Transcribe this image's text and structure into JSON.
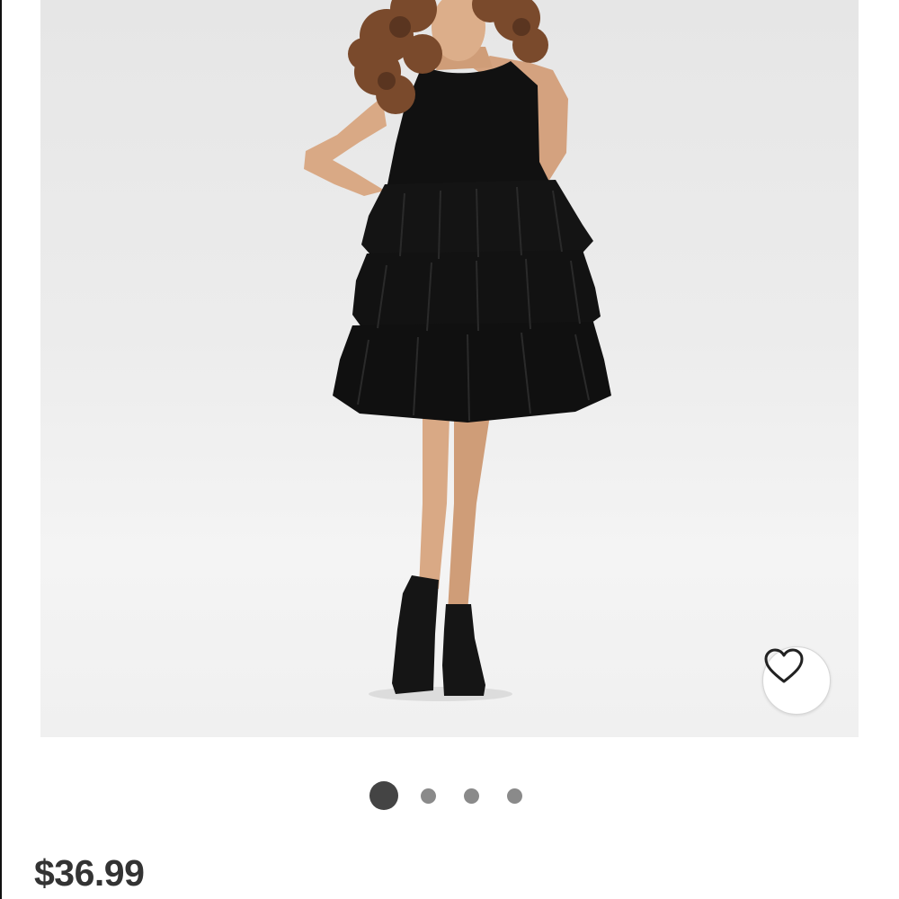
{
  "product": {
    "price": "$36.99"
  },
  "favorite": {
    "icon": "heart-outline-icon"
  },
  "carousel": {
    "total_images": 4,
    "active_index": 0
  },
  "colors": {
    "price_text": "#333333",
    "active_dot": "#444444",
    "inactive_dot": "#8a8a8a",
    "image_background": "#ececec"
  }
}
